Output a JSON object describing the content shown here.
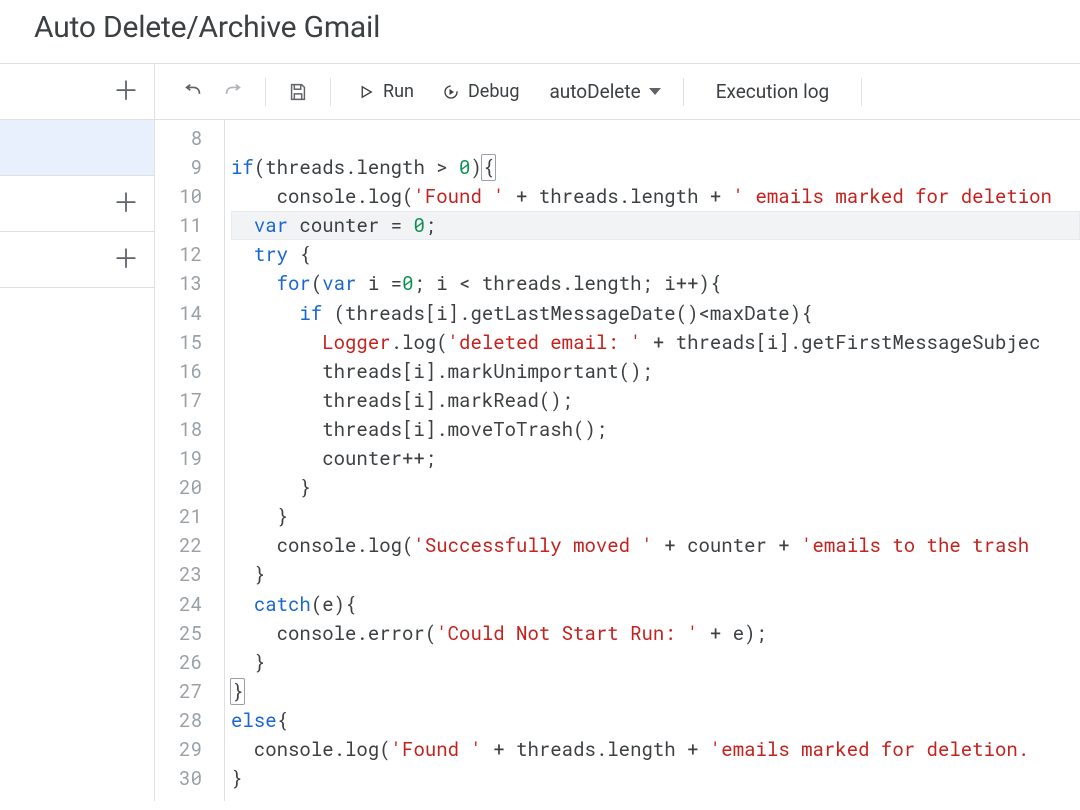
{
  "header": {
    "title": "Auto Delete/Archive Gmail"
  },
  "toolbar": {
    "run": "Run",
    "debug": "Debug",
    "function_selected": "autoDelete",
    "execution_log": "Execution log"
  },
  "editor": {
    "first_line_number": 8,
    "last_line_number": 30,
    "cursor_line": 11,
    "code_lines_tokens": [
      [],
      [
        [
          "kw",
          "if"
        ],
        [
          "punct",
          "(threads.length > "
        ],
        [
          "num",
          "0"
        ],
        [
          "punct",
          ")"
        ],
        [
          "bracket",
          "{"
        ]
      ],
      [
        [
          "punct",
          "    console.log("
        ],
        [
          "str",
          "'Found '"
        ],
        [
          "punct",
          " + threads.length + "
        ],
        [
          "str",
          "' emails marked for deletion"
        ]
      ],
      [
        [
          "punct",
          "  "
        ],
        [
          "kw",
          "var"
        ],
        [
          "punct",
          " counter = "
        ],
        [
          "num",
          "0"
        ],
        [
          "punct",
          ";"
        ]
      ],
      [
        [
          "punct",
          "  "
        ],
        [
          "kw",
          "try"
        ],
        [
          "punct",
          " {"
        ]
      ],
      [
        [
          "punct",
          "    "
        ],
        [
          "kw",
          "for"
        ],
        [
          "punct",
          "("
        ],
        [
          "kw",
          "var"
        ],
        [
          "punct",
          " i ="
        ],
        [
          "num",
          "0"
        ],
        [
          "punct",
          "; i < threads.length; i++){"
        ]
      ],
      [
        [
          "punct",
          "      "
        ],
        [
          "kw",
          "if"
        ],
        [
          "punct",
          " (threads[i].getLastMessageDate()<maxDate){"
        ]
      ],
      [
        [
          "punct",
          "        "
        ],
        [
          "err",
          "Logger"
        ],
        [
          "punct",
          ".log("
        ],
        [
          "str",
          "'deleted email: '"
        ],
        [
          "punct",
          " + threads[i].getFirstMessageSubjec"
        ]
      ],
      [
        [
          "punct",
          "        threads[i].markUnimportant();"
        ]
      ],
      [
        [
          "punct",
          "        threads[i].markRead();"
        ]
      ],
      [
        [
          "punct",
          "        threads[i].moveToTrash();"
        ]
      ],
      [
        [
          "punct",
          "        counter++;"
        ]
      ],
      [
        [
          "punct",
          "      }"
        ]
      ],
      [
        [
          "punct",
          "    }"
        ]
      ],
      [
        [
          "punct",
          "    console.log("
        ],
        [
          "str",
          "'Successfully moved '"
        ],
        [
          "punct",
          " + counter + "
        ],
        [
          "str",
          "'emails to the trash"
        ]
      ],
      [
        [
          "punct",
          "  }"
        ]
      ],
      [
        [
          "punct",
          "  "
        ],
        [
          "kw",
          "catch"
        ],
        [
          "punct",
          "(e){"
        ]
      ],
      [
        [
          "punct",
          "    console.error("
        ],
        [
          "str",
          "'Could Not Start Run: '"
        ],
        [
          "punct",
          " + e);"
        ]
      ],
      [
        [
          "punct",
          "  }"
        ]
      ],
      [
        [
          "bracket",
          "}"
        ]
      ],
      [
        [
          "kw",
          "else"
        ],
        [
          "punct",
          "{"
        ]
      ],
      [
        [
          "punct",
          "  console.log("
        ],
        [
          "str",
          "'Found '"
        ],
        [
          "punct",
          " + threads.length + "
        ],
        [
          "str",
          "'emails marked for deletion. "
        ]
      ],
      [
        [
          "punct",
          "}"
        ]
      ]
    ]
  }
}
